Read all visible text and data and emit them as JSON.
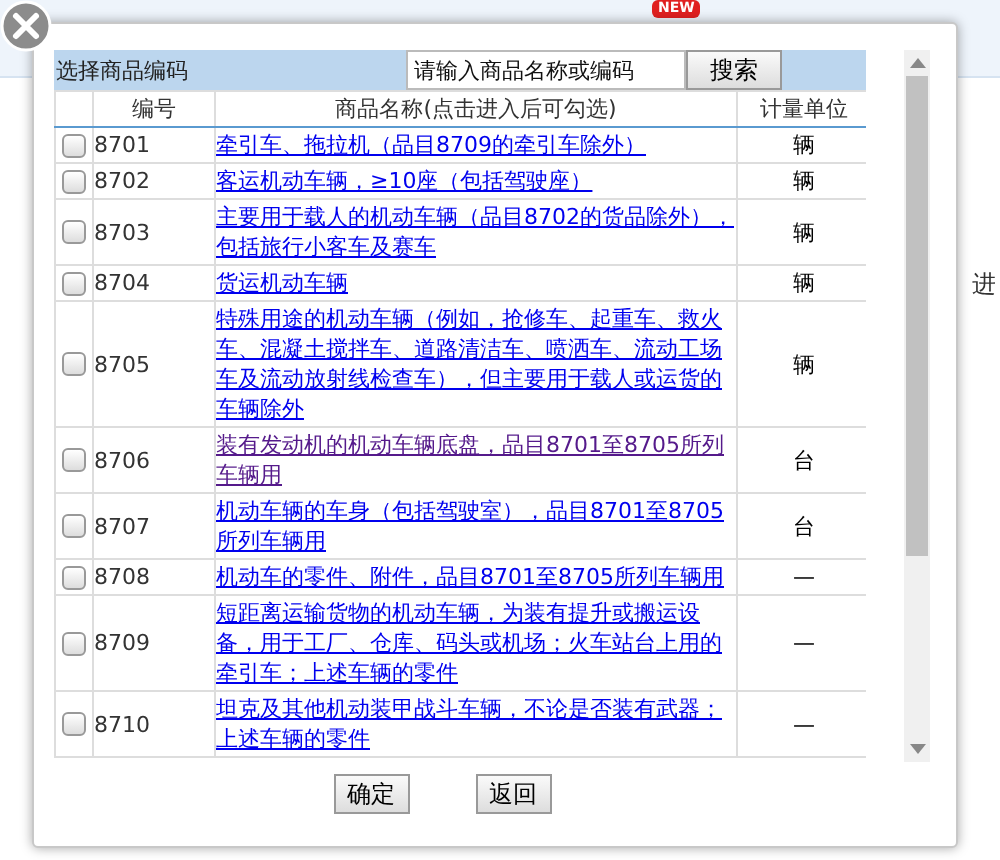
{
  "background": {
    "badge": "NEW",
    "fragment": "进"
  },
  "dialog": {
    "title": "选择商品编码",
    "search": {
      "placeholder": "请输入商品名称或编码"
    },
    "search_button": "搜索",
    "table": {
      "columns": [
        "编号",
        "商品名称(点击进入后可勾选)",
        "计量单位"
      ],
      "rows": [
        {
          "code": "8701",
          "name": "牵引车、拖拉机（品目8709的牵引车除外）",
          "unit": "辆",
          "checked": false,
          "visited": false
        },
        {
          "code": "8702",
          "name": "客运机动车辆，≥10座（包括驾驶座）",
          "unit": "辆",
          "checked": false,
          "visited": false
        },
        {
          "code": "8703",
          "name": "主要用于载人的机动车辆（品目8702的货品除外），包括旅行小客车及赛车",
          "unit": "辆",
          "checked": false,
          "visited": false
        },
        {
          "code": "8704",
          "name": "货运机动车辆",
          "unit": "辆",
          "checked": false,
          "visited": false
        },
        {
          "code": "8705",
          "name": "特殊用途的机动车辆（例如，抢修车、起重车、救火车、混凝土搅拌车、道路清洁车、喷洒车、流动工场车及流动放射线检查车），但主要用于载人或运货的车辆除外",
          "unit": "辆",
          "checked": false,
          "visited": false
        },
        {
          "code": "8706",
          "name": "装有发动机的机动车辆底盘，品目8701至8705所列车辆用",
          "unit": "台",
          "checked": false,
          "visited": true
        },
        {
          "code": "8707",
          "name": "机动车辆的车身（包括驾驶室），品目8701至8705所列车辆用",
          "unit": "台",
          "checked": false,
          "visited": false
        },
        {
          "code": "8708",
          "name": "机动车的零件、附件，品目8701至8705所列车辆用",
          "unit": "—",
          "checked": false,
          "visited": false
        },
        {
          "code": "8709",
          "name": "短距离运输货物的机动车辆，为装有提升或搬运设备，用于工厂、仓库、码头或机场；火车站台上用的牵引车；上述车辆的零件",
          "unit": "—",
          "checked": false,
          "visited": false
        },
        {
          "code": "8710",
          "name": "坦克及其他机动装甲战斗车辆，不论是否装有武器；上述车辆的零件",
          "unit": "—",
          "checked": false,
          "visited": false
        }
      ]
    },
    "buttons": [
      "确定",
      "返回"
    ]
  }
}
